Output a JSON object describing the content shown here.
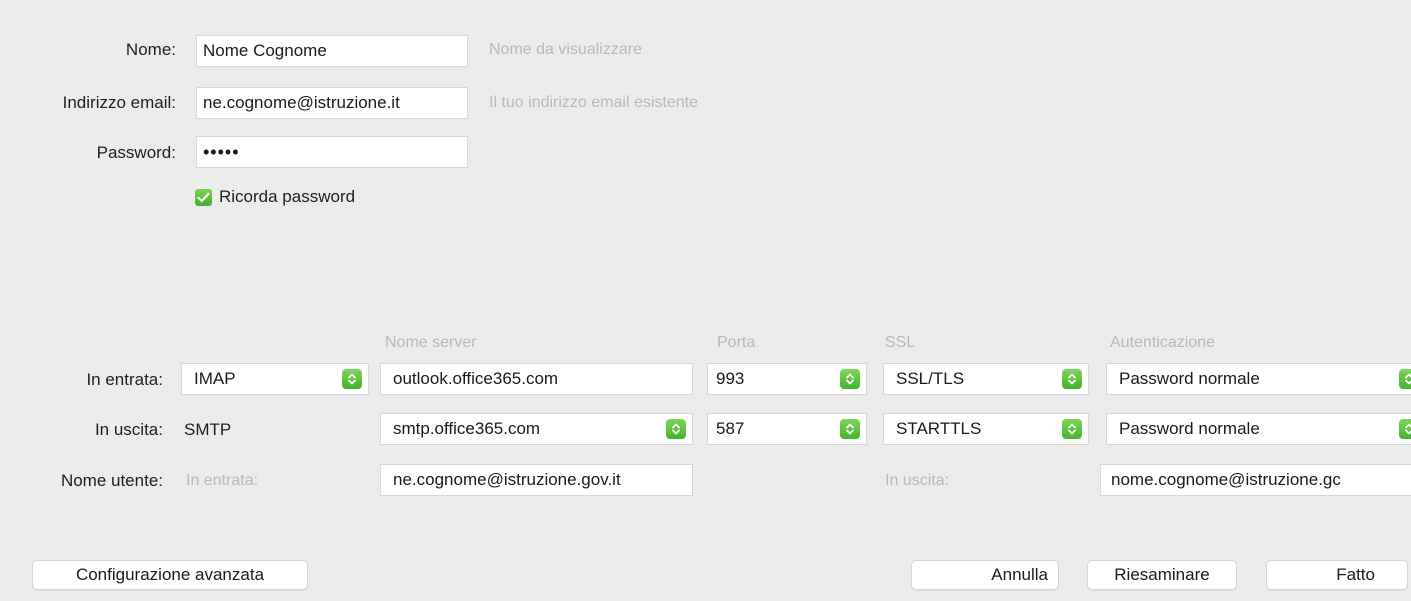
{
  "account": {
    "name_label": "Nome:",
    "name_value": "Nome Cognome",
    "name_hint": "Nome da visualizzare",
    "email_label": "Indirizzo email:",
    "email_value": "ne.cognome@istruzione.it",
    "email_hint": "Il tuo indirizzo email esistente",
    "password_label": "Password:",
    "password_value": "•••••",
    "remember_label": "Ricorda password",
    "remember_checked": true
  },
  "servers": {
    "headers": {
      "server": "Nome server",
      "port": "Porta",
      "ssl": "SSL",
      "auth": "Autenticazione"
    },
    "incoming": {
      "label": "In entrata:",
      "protocol": "IMAP",
      "server": "outlook.office365.com",
      "port": "993",
      "ssl": "SSL/TLS",
      "auth": "Password normale"
    },
    "outgoing": {
      "label": "In uscita:",
      "protocol": "SMTP",
      "server": "smtp.office365.com",
      "port": "587",
      "ssl": "STARTTLS",
      "auth": "Password normale"
    },
    "username": {
      "label": "Nome utente:",
      "incoming_label": "In entrata:",
      "incoming_value": "ne.cognome@istruzione.gov.it",
      "outgoing_label": "In uscita:",
      "outgoing_value": "nome.cognome@istruzione.gc"
    }
  },
  "buttons": {
    "advanced": "Configurazione avanzata",
    "cancel": "Annulla",
    "retest": "Riesaminare",
    "done": "Fatto"
  },
  "colors": {
    "accent_green": "#4cb631",
    "background": "#ececec"
  }
}
